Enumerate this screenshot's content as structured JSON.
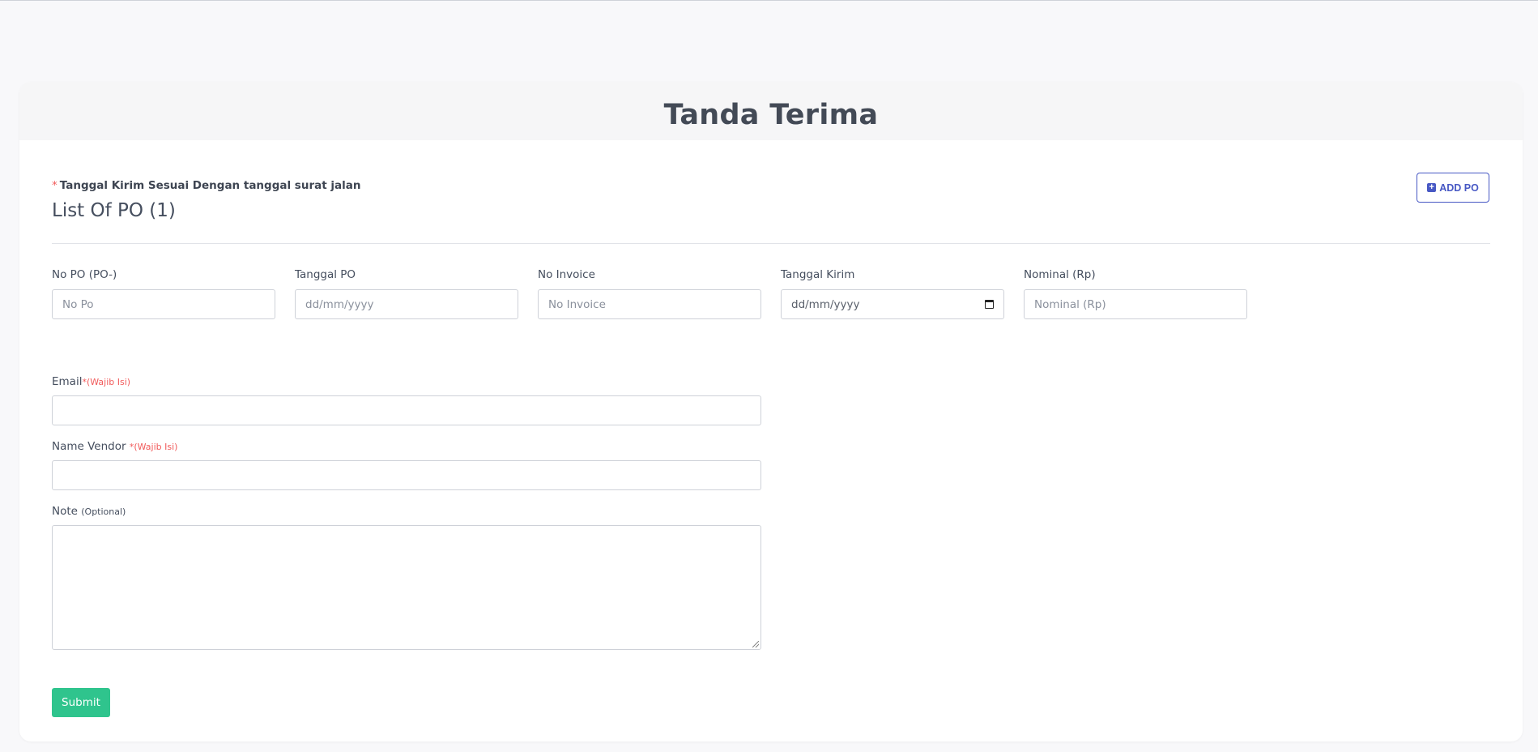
{
  "page": {
    "title": "Tanda Terima"
  },
  "notice": {
    "star": "*",
    "text": "Tanggal Kirim Sesuai Dengan tanggal surat jalan"
  },
  "list": {
    "title": "List Of PO (1)",
    "add_label": "ADD PO",
    "add_icon": "plus-square-icon"
  },
  "po_row": {
    "no_po": {
      "label": "No PO (PO-)",
      "placeholder": "No Po"
    },
    "tanggal_po": {
      "label": "Tanggal PO",
      "placeholder": "dd/mm/yyyy"
    },
    "no_invoice": {
      "label": "No Invoice",
      "placeholder": "No Invoice"
    },
    "tanggal_kirim": {
      "label": "Tanggal Kirim",
      "value": "dd/mm/yyyy",
      "icon": "calendar-icon"
    },
    "nominal": {
      "label": "Nominal (Rp)",
      "placeholder": "Nominal (Rp)"
    }
  },
  "form": {
    "email": {
      "label": "Email",
      "required": "*(Wajib Isi)",
      "value": ""
    },
    "vendor": {
      "label": "Name Vendor ",
      "required": "*(Wajib Isi)",
      "value": ""
    },
    "note": {
      "label": "Note ",
      "optional": "(Optional)",
      "value": ""
    }
  },
  "submit_label": "Submit",
  "colors": {
    "accent": "#4758c4",
    "submit": "#2fc48d",
    "required": "#f15a5a"
  }
}
